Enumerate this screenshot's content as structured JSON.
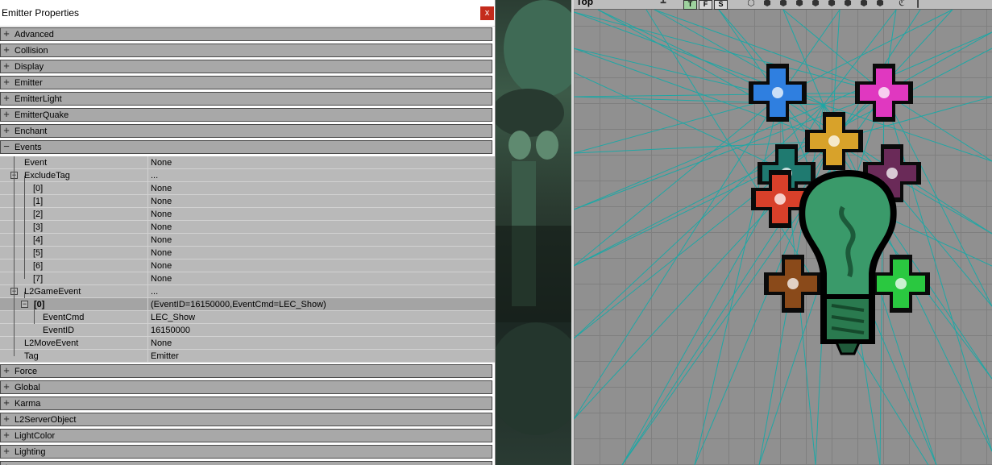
{
  "window": {
    "title": "Emitter Properties",
    "close_glyph": "x"
  },
  "categories_top": [
    {
      "label": "Advanced",
      "expander": "+"
    },
    {
      "label": "Collision",
      "expander": "+"
    },
    {
      "label": "Display",
      "expander": "+"
    },
    {
      "label": "Emitter",
      "expander": "+"
    },
    {
      "label": "EmitterLight",
      "expander": "+"
    },
    {
      "label": "EmitterQuake",
      "expander": "+"
    },
    {
      "label": "Enchant",
      "expander": "+"
    },
    {
      "label": "Events",
      "expander": "−"
    }
  ],
  "events": {
    "event": {
      "name": "Event",
      "value": "None"
    },
    "exclude_tag": {
      "name": "ExcludeTag",
      "value": "...",
      "box": "−"
    },
    "exclude_items": [
      {
        "name": "[0]",
        "value": "None"
      },
      {
        "name": "[1]",
        "value": "None"
      },
      {
        "name": "[2]",
        "value": "None"
      },
      {
        "name": "[3]",
        "value": "None"
      },
      {
        "name": "[4]",
        "value": "None"
      },
      {
        "name": "[5]",
        "value": "None"
      },
      {
        "name": "[6]",
        "value": "None"
      },
      {
        "name": "[7]",
        "value": "None"
      }
    ],
    "l2_game_event": {
      "name": "L2GameEvent",
      "value": "...",
      "box": "−"
    },
    "game_event_0": {
      "name": "[0]",
      "value": "(EventID=16150000,EventCmd=LEC_Show)",
      "box": "−"
    },
    "event_cmd": {
      "name": "EventCmd",
      "value": "LEC_Show"
    },
    "event_id": {
      "name": "EventID",
      "value": "16150000"
    },
    "l2_move_event": {
      "name": "L2MoveEvent",
      "value": "None"
    },
    "tag": {
      "name": "Tag",
      "value": "Emitter"
    }
  },
  "categories_bottom": [
    {
      "label": "Force",
      "expander": "+"
    },
    {
      "label": "Global",
      "expander": "+"
    },
    {
      "label": "Karma",
      "expander": "+"
    },
    {
      "label": "L2ServerObject",
      "expander": "+"
    },
    {
      "label": "LightColor",
      "expander": "+"
    },
    {
      "label": "Lighting",
      "expander": "+"
    },
    {
      "label": "",
      "expander": "+"
    }
  ],
  "viewport": {
    "label": "Top",
    "toolbar_buttons": [
      "T",
      "F",
      "S"
    ],
    "toolbar_icons": [
      "viewport-options-icon",
      "wireframe-cube-icon",
      "solid-cube-icon",
      "textured-cube-icon",
      "lit-cube-icon",
      "zone-cube-icon",
      "dynamic-light-cube-icon",
      "bsp-cube-icon",
      "unlit-cube-icon",
      "realtime-preview-icon",
      "pin-icon"
    ],
    "line_color": "#1fa7a5",
    "sprites": [
      {
        "name": "blue-cross-sprite",
        "color": "#2f7fe0"
      },
      {
        "name": "magenta-cross-sprite",
        "color": "#e038c0"
      },
      {
        "name": "gold-cross-sprite",
        "color": "#d8a22a"
      },
      {
        "name": "teal-cross-sprite",
        "color": "#1f7a70"
      },
      {
        "name": "purple-cross-sprite",
        "color": "#6a2a58"
      },
      {
        "name": "red-cross-sprite",
        "color": "#d8402a"
      },
      {
        "name": "brown-cross-sprite",
        "color": "#8a4a1a"
      },
      {
        "name": "green-cross-sprite",
        "color": "#2ac840"
      }
    ],
    "lightbulb_color": "#3a9a6a"
  }
}
